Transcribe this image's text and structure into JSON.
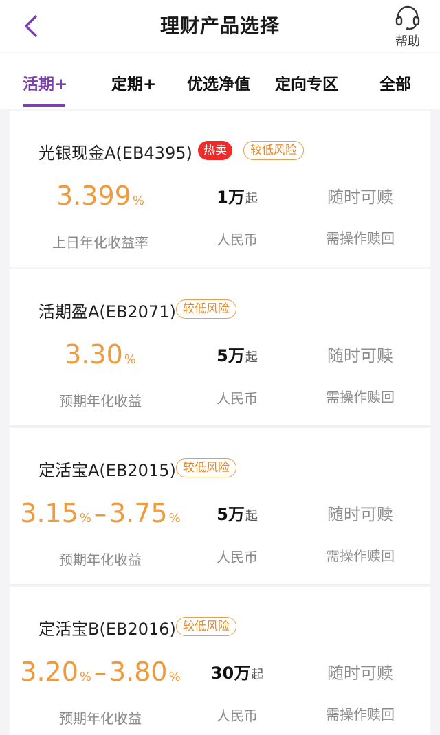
{
  "header": {
    "title": "理财产品选择",
    "help_label": "帮助"
  },
  "colors": {
    "accent": "#7b3fb0",
    "rate": "#ef9a3c",
    "hot": "#ef2a2a",
    "risk": "#e08a2a"
  },
  "tabs": [
    {
      "label": "活期+",
      "active": true
    },
    {
      "label": "定期+",
      "active": false
    },
    {
      "label": "优选净值",
      "active": false
    },
    {
      "label": "定向专区",
      "active": false
    },
    {
      "label": "全部",
      "active": false
    }
  ],
  "products": [
    {
      "name": "光银现金A(EB4395)",
      "hot_tag": "热卖",
      "risk_tag": "较低风险",
      "rate_low": "3.399",
      "rate_low_unit": "%",
      "rate_label": "上日年化收益率",
      "amount": "1万",
      "amount_suffix": "起",
      "currency": "人民币",
      "redeem": "随时可赎",
      "redeem_note": "需操作赎回"
    },
    {
      "name": "活期盈A(EB2071)",
      "risk_tag": "较低风险",
      "rate_low": "3.30",
      "rate_low_unit": "%",
      "rate_label": "预期年化收益",
      "amount": "5万",
      "amount_suffix": "起",
      "currency": "人民币",
      "redeem": "随时可赎",
      "redeem_note": "需操作赎回"
    },
    {
      "name": "定活宝A(EB2015)",
      "risk_tag": "较低风险",
      "rate_low": "3.15",
      "rate_low_unit": "%",
      "rate_sep": "–",
      "rate_high": "3.75",
      "rate_high_unit": "%",
      "rate_label": "预期年化收益",
      "amount": "5万",
      "amount_suffix": "起",
      "currency": "人民币",
      "redeem": "随时可赎",
      "redeem_note": "需操作赎回"
    },
    {
      "name": "定活宝B(EB2016)",
      "risk_tag": "较低风险",
      "rate_low": "3.20",
      "rate_low_unit": "%",
      "rate_sep": "–",
      "rate_high": "3.80",
      "rate_high_unit": "%",
      "rate_label": "预期年化收益",
      "amount": "30万",
      "amount_suffix": "起",
      "currency": "人民币",
      "redeem": "随时可赎",
      "redeem_note": "需操作赎回"
    }
  ]
}
